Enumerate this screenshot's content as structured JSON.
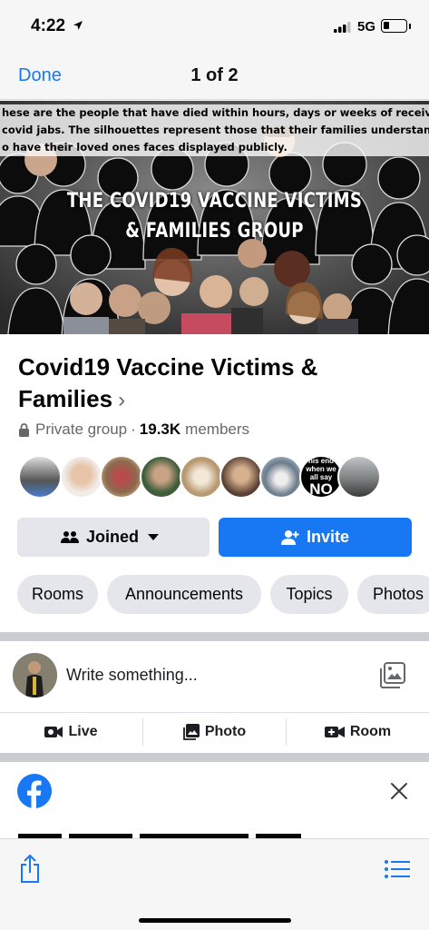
{
  "status_bar": {
    "time": "4:22",
    "network": "5G"
  },
  "nav": {
    "done_label": "Done",
    "pager": "1 of 2"
  },
  "cover": {
    "caption_lines": [
      "hese are the people that have died within hours, days or weeks of receiving one of the",
      "covid jabs. The silhouettes represent those that their families understandably don't wish",
      "o have their loved ones faces displayed publicly."
    ],
    "title_lines": [
      "THE COVID19 VACCINE VICTIMS",
      "& FAMILIES GROUP"
    ]
  },
  "group": {
    "name": "Covid19 Vaccine Victims & Families",
    "chevron": "›",
    "privacy": "Private group",
    "separator": "·",
    "member_count": "19.3K",
    "members_label": "members",
    "member_avatar_text": {
      "line1": "his end",
      "line2": "when we",
      "line3": "all say",
      "line4": "NO"
    }
  },
  "buttons": {
    "joined": "Joined",
    "invite": "Invite"
  },
  "chips": [
    "Rooms",
    "Announcements",
    "Topics",
    "Photos"
  ],
  "composer": {
    "placeholder": "Write something...",
    "actions": {
      "live": "Live",
      "photo": "Photo",
      "room": "Room"
    }
  },
  "colors": {
    "brand_blue": "#1877f2",
    "chip_gray": "#e4e6eb",
    "divider_gray": "#c9ccd1"
  },
  "icons": [
    "location-arrow-icon",
    "signal-icon",
    "battery-icon",
    "lock-icon",
    "chevron-right-icon",
    "people-icon",
    "caret-down-icon",
    "add-person-icon",
    "photo-gallery-icon",
    "live-video-icon",
    "photo-icon",
    "room-video-icon",
    "facebook-logo-icon",
    "close-icon",
    "share-icon",
    "list-icon"
  ]
}
